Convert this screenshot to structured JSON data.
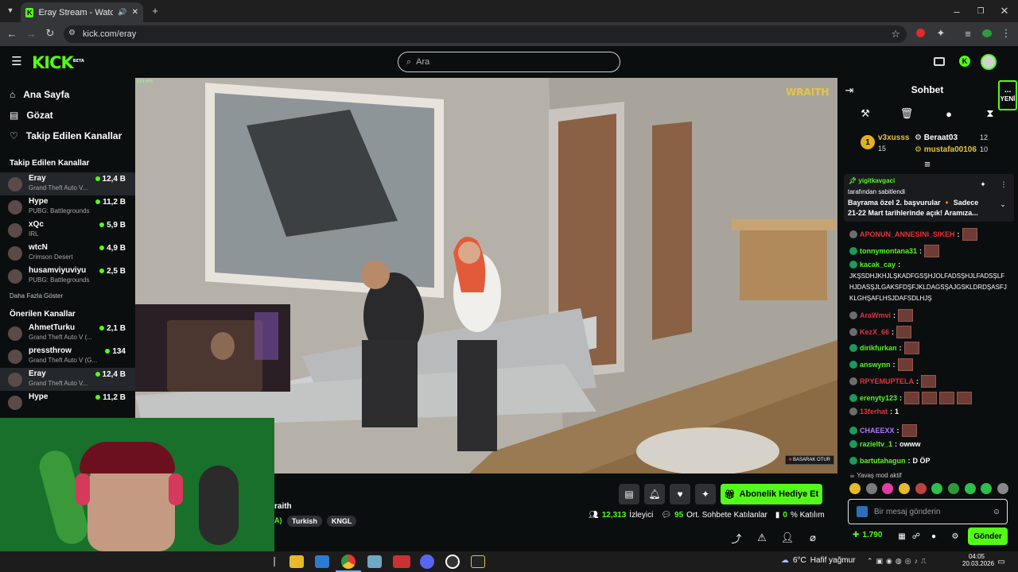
{
  "browser": {
    "tab_title": "Eray Stream - Watch Live o",
    "url": "kick.com/eray"
  },
  "header": {
    "logo": "KICK",
    "logo_sub": "BETA",
    "search_placeholder": "Ara"
  },
  "sidebar": {
    "nav": [
      {
        "label": "Ana Sayfa",
        "icon": "home-icon"
      },
      {
        "label": "Gözat",
        "icon": "browse-icon"
      },
      {
        "label": "Takip Edilen Kanallar",
        "icon": "heart-icon"
      }
    ],
    "followed_title": "Takip Edilen Kanallar",
    "followed": [
      {
        "name": "Eray",
        "game": "Grand Theft Auto V...",
        "viewers": "12,4 B",
        "selected": true
      },
      {
        "name": "Hype",
        "game": "PUBG: Battlegrounds",
        "viewers": "11,2 B"
      },
      {
        "name": "xQc",
        "game": "IRL",
        "viewers": "5,9 B"
      },
      {
        "name": "wtcN",
        "game": "Crimson Desert",
        "viewers": "4,9 B"
      },
      {
        "name": "husamviyuviyu",
        "game": "PUBG: Battlegrounds",
        "viewers": "2,5 B"
      }
    ],
    "show_more": "Daha Fazla Göster",
    "recommended_title": "Önerilen Kanallar",
    "recommended": [
      {
        "name": "AhmetTurku",
        "game": "Grand Theft Auto V (...",
        "viewers": "2,1 B"
      },
      {
        "name": "pressthrow",
        "game": "Grand Theft Auto V (G...",
        "viewers": "134"
      },
      {
        "name": "Eray",
        "game": "Grand Theft Auto V...",
        "viewers": "12,4 B",
        "selected": true
      },
      {
        "name": "Hype",
        "game": "",
        "viewers": "11,2 B"
      }
    ]
  },
  "video": {
    "fps": "153 FPS",
    "server_logo": "WRAITH",
    "hud_label": "BASARAK OTUR"
  },
  "stream_info": {
    "title_fragment": "raith",
    "tag_prefix": "A)",
    "tags": [
      "Turkish",
      "KNGL"
    ],
    "viewers_count": "12,313",
    "viewers_label": "İzleyici",
    "chatters_count": "95",
    "chatters_label": "Ort. Sohbete Katılanlar",
    "engagement_value": "0",
    "engagement_label": "% Katılım",
    "gift_button": "Abonelik Hediye Et"
  },
  "chat": {
    "title": "Sohbet",
    "new_label": "YENİ",
    "leaderboard": [
      {
        "rank": "1",
        "name": "v3xusss",
        "count": "15"
      },
      {
        "name": "Beraat03",
        "count": "12"
      },
      {
        "name": "mustafa00106",
        "count": "10"
      }
    ],
    "pinned": {
      "user": "yigitkavgaci",
      "pinned_by": "tarafından sabitlendi",
      "text_line1": "Bayrama özel 2. başvurular 🔸 Sadece",
      "text_line2": "21-22 Mart tarihlerinde açık! Aramıza..."
    },
    "messages": [
      {
        "user": "APONUN_ANNESINI_SIKEH",
        "color": "#e5333a",
        "text": "",
        "emotes": 1
      },
      {
        "user": "tonnymontana31",
        "color": "#53fc18",
        "text": "",
        "emotes": 1
      },
      {
        "user": "kacak_cay",
        "color": "#53fc18",
        "text": "JKŞSDHJKHJLŞKADFGSŞHJOLFADSŞHJLFADSŞLFHJDASŞJLGAKSFDŞFJKLDAGSŞAJGSKLDRDŞASFJKLGHŞAFLHSJDAFSDLHJŞ",
        "emotes": 0
      },
      {
        "user": "AraWmvi",
        "color": "#e5333a",
        "text": "",
        "emotes": 1
      },
      {
        "user": "KezX_66",
        "color": "#e5333a",
        "text": "",
        "emotes": 1
      },
      {
        "user": "dirikfurkan",
        "color": "#53fc18",
        "text": "",
        "emotes": 1
      },
      {
        "user": "answynn",
        "color": "#53fc18",
        "text": "",
        "emotes": 1
      },
      {
        "user": "RPYEMUPTELA",
        "color": "#e5333a",
        "text": "",
        "emotes": 1
      },
      {
        "user": "erenyty123",
        "color": "#53fc18",
        "text": "",
        "emotes": 4
      },
      {
        "user": "13ferhat",
        "color": "#e5333a",
        "text": "1",
        "emotes": 0
      },
      {
        "user": "CHAEEXX",
        "color": "#b07bff",
        "text": "",
        "emotes": 1
      },
      {
        "user": "razieltv_1",
        "color": "#53fc18",
        "text": "owww",
        "emotes": 0
      },
      {
        "user": "bartutahagun",
        "color": "#53fc18",
        "text": "D ÖP",
        "emotes": 0
      }
    ],
    "slow_mode": "Yavaş mod aktif",
    "input_placeholder": "Bir mesaj gönderin",
    "points": "1.790",
    "send_button": "Gönder"
  },
  "taskbar": {
    "temp": "6°C",
    "weather": "Hafif yağmur",
    "time": "04:05",
    "date": "20.03.2026"
  },
  "colors": {
    "accent": "#53fc18",
    "bg": "#0b0e0f"
  }
}
